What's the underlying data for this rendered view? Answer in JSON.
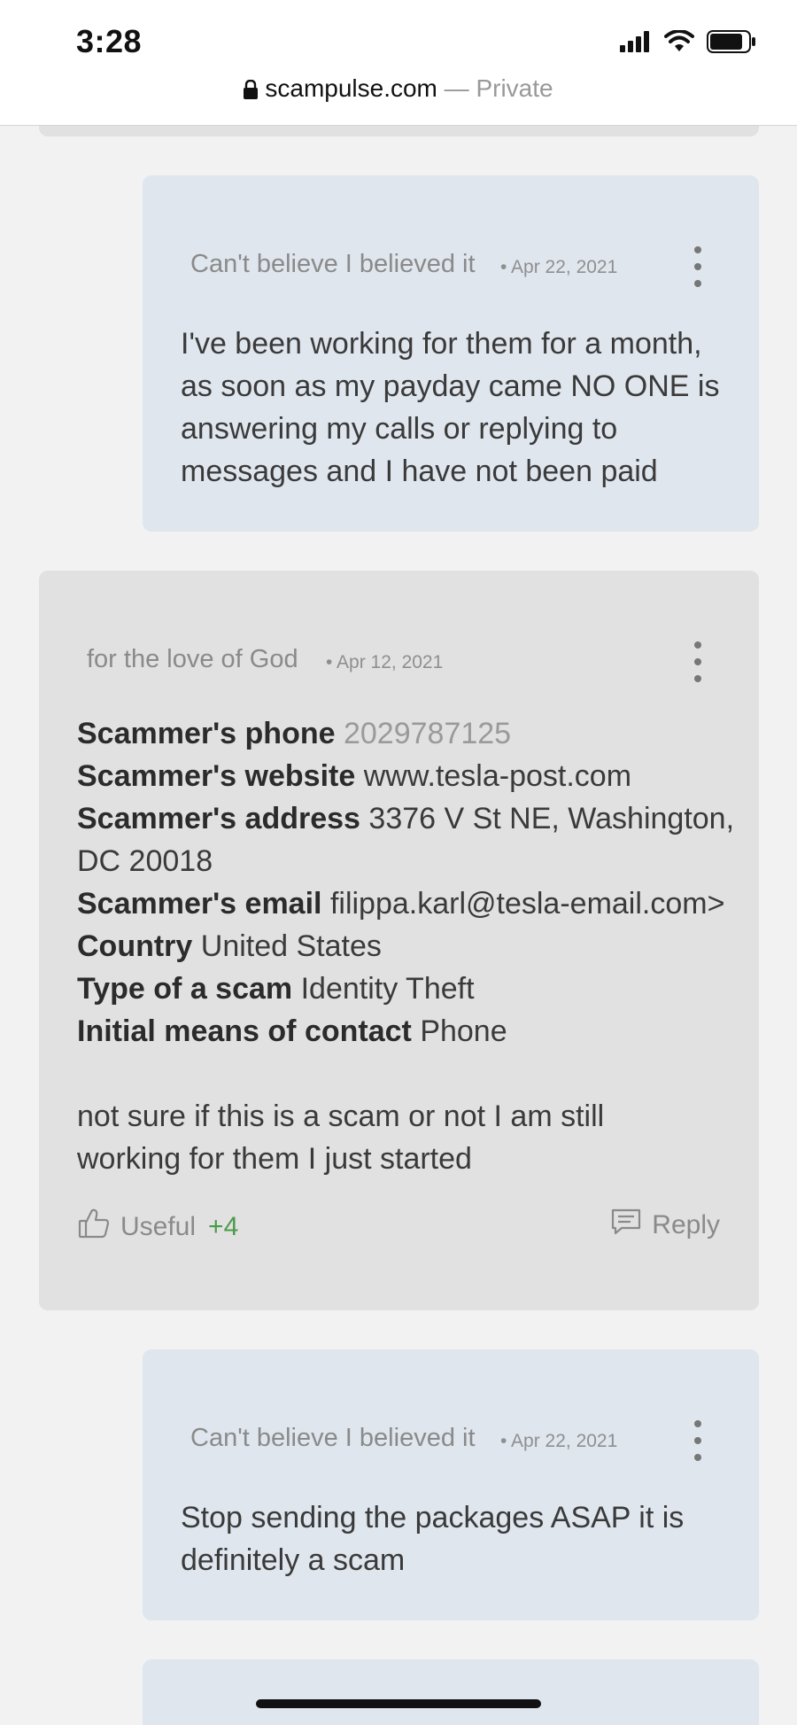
{
  "status_bar": {
    "time": "3:28",
    "icons": [
      "cellular-signal-icon",
      "wifi-icon",
      "battery-icon"
    ]
  },
  "browser": {
    "domain": "scampulse.com",
    "separator": " — ",
    "mode": "Private"
  },
  "comments": [
    {
      "author": "Can't believe I believed it",
      "date": "• Apr 22, 2021",
      "text": "I've been working for them for a month, as soon as my payday came NO ONE is answering my calls or replying to messages and I have not been paid"
    },
    {
      "author": "for the love of God",
      "date": "• Apr 12, 2021",
      "fields": {
        "phone_label": "Scammer's phone",
        "phone_value": "2029787125",
        "website_label": "Scammer's website",
        "website_value": "www.tesla-post.com",
        "address_label": "Scammer's address",
        "address_value": "3376 V St NE, Washington, DC 20018",
        "email_label": "Scammer's email",
        "email_value": "filippa.karl@tesla-email.com>",
        "country_label": "Country",
        "country_value": "United States",
        "type_label": "Type of a scam",
        "type_value": "Identity Theft",
        "contact_label": "Initial means of contact",
        "contact_value": "Phone"
      },
      "text": "not sure if this is a scam or not I am still working for them I just started",
      "useful_label": "Useful",
      "useful_count": "+4",
      "reply_label": "Reply"
    },
    {
      "author": "Can't believe I believed it",
      "date": "• Apr 22, 2021",
      "text": "Stop sending the packages ASAP it is definitely a scam"
    }
  ]
}
